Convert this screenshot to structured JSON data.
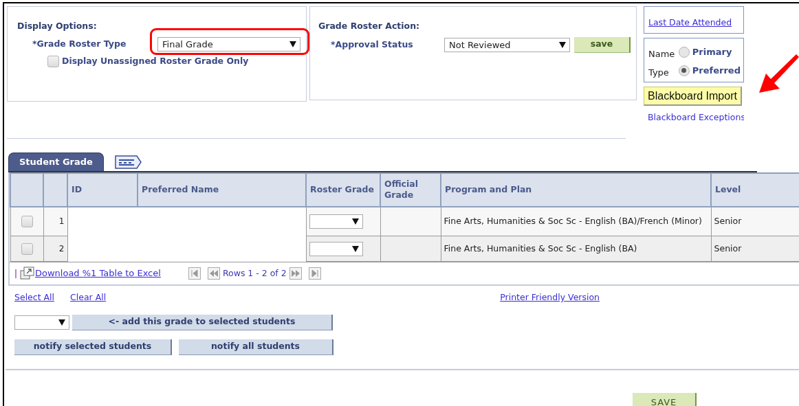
{
  "display_options": {
    "title": "Display Options:",
    "roster_type_label": "*Grade Roster Type",
    "roster_type_value": "Final Grade",
    "unassigned_only": {
      "label": "Display Unassigned Roster Grade Only",
      "checked": false
    }
  },
  "roster_action": {
    "title": "Grade Roster Action:",
    "approval_label": "*Approval Status",
    "approval_value": "Not Reviewed",
    "save_button": "save"
  },
  "last_date_link": "Last Date Attended",
  "name_type": {
    "label_line_1": "Name",
    "label_line_2": "Type",
    "options": [
      {
        "label": "Primary",
        "selected": false
      },
      {
        "label": "Preferred",
        "selected": true
      }
    ]
  },
  "blackboard_import": "Blackboard Import",
  "blackboard_exceptions": "Blackboard Exceptions",
  "tab": {
    "label": "Student Grade",
    "selected": true
  },
  "table": {
    "columns": [
      "ID",
      "Preferred Name",
      "Roster Grade",
      "Official Grade",
      "Program and Plan",
      "Level"
    ],
    "rows": [
      {
        "number": "1",
        "checked": false,
        "program": "Fine Arts, Humanities & Soc Sc - English (BA)/French (Minor)",
        "level": "Senior"
      },
      {
        "number": "2",
        "checked": false,
        "program": "Fine Arts, Humanities & Soc Sc - English (BA)",
        "level": "Senior"
      }
    ],
    "download_link": "Download %1 Table to Excel",
    "rows_info": "Rows 1 - 2 of 2"
  },
  "select_all": "Select All",
  "clear_all": "Clear All",
  "printer_friendly": "Printer Friendly Version",
  "add_grade_button": "<- add this grade to selected students",
  "notify_buttons": [
    "notify selected students",
    "notify all students"
  ],
  "save_button": "SAVE"
}
